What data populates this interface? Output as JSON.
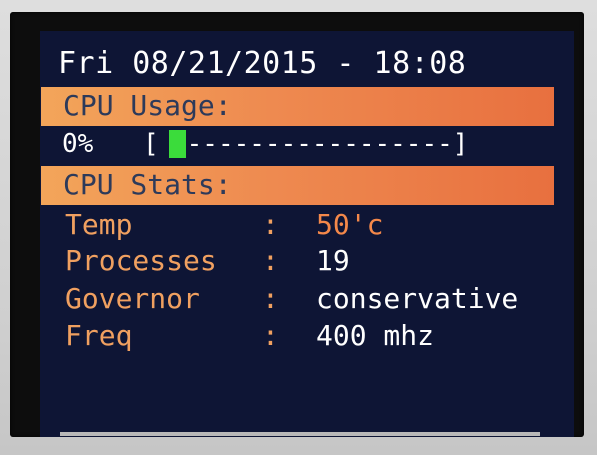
{
  "status": {
    "datetime": "Fri 08/21/2015 - 18:08"
  },
  "cpu_usage": {
    "header": "CPU Usage:",
    "percent_text": "0%",
    "bar_left": "[",
    "bar_track": "-----------------]",
    "bar_fill_fraction": 0.0,
    "bar_fill_color": "#3bdc3b"
  },
  "cpu_stats": {
    "header": "CPU Stats:",
    "separator": ":",
    "rows": [
      {
        "label": "Temp",
        "value": "50'c"
      },
      {
        "label": "Processes",
        "value": "19"
      },
      {
        "label": "Governor",
        "value": "conservative"
      },
      {
        "label": "Freq",
        "value": "400 mhz"
      }
    ]
  },
  "colors": {
    "background": "#0e1535",
    "header_bar": "#ee8a50",
    "label": "#f0a060",
    "value": "#ffffff",
    "temp_value": "#f4884a"
  }
}
